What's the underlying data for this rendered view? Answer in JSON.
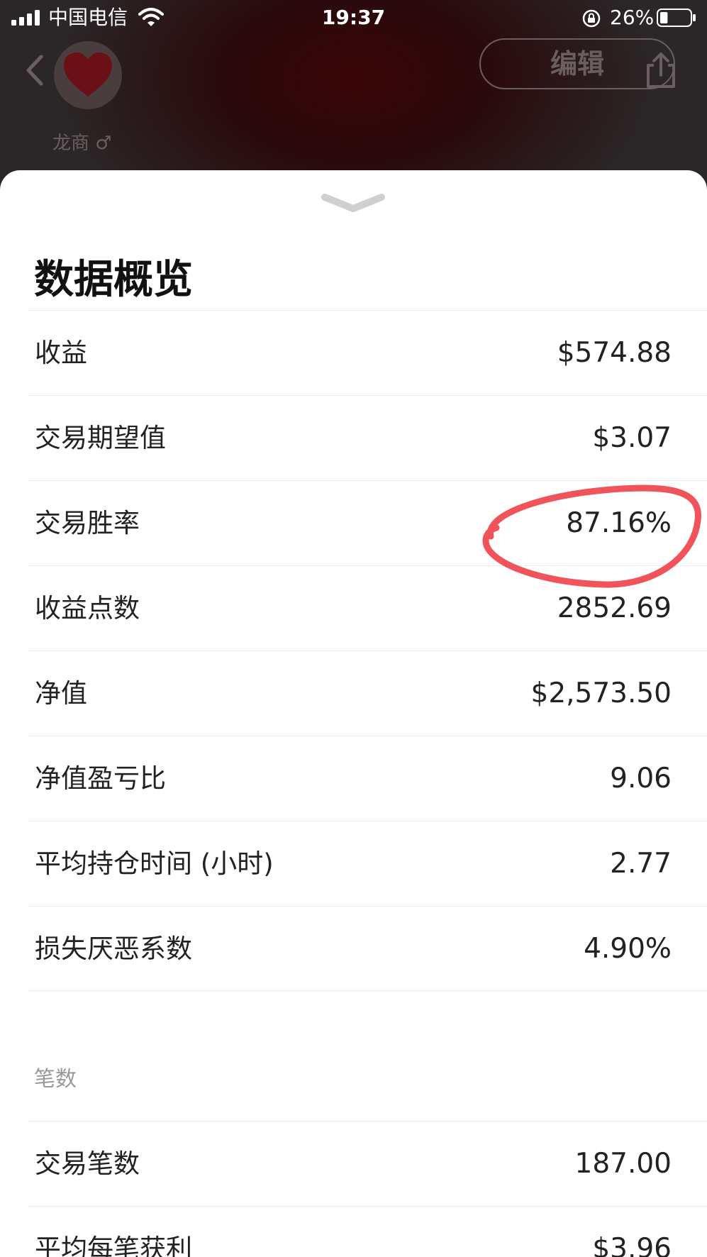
{
  "status_bar": {
    "carrier": "中国电信",
    "time": "19:37",
    "battery_percent": "26%",
    "battery_level": 0.26
  },
  "header": {
    "username": "龙商 ♂",
    "edit_label": "编辑"
  },
  "overview": {
    "title": "数据概览",
    "stats": [
      {
        "label": "收益",
        "value": "$574.88"
      },
      {
        "label": "交易期望值",
        "value": "$3.07"
      },
      {
        "label": "交易胜率",
        "value": "87.16%"
      },
      {
        "label": "收益点数",
        "value": "2852.69"
      },
      {
        "label": "净值",
        "value": "$2,573.50"
      },
      {
        "label": "净值盈亏比",
        "value": "9.06"
      },
      {
        "label": "平均持仓时间 (小时)",
        "value": "2.77"
      },
      {
        "label": "损失厌恶系数",
        "value": "4.90%"
      }
    ]
  },
  "trades": {
    "section_label": "笔数",
    "stats": [
      {
        "label": "交易笔数",
        "value": "187.00"
      },
      {
        "label": "平均每笔获利",
        "value": "$3.96"
      }
    ]
  },
  "colors": {
    "highlight": "#f0545a",
    "backdrop": "#2b2627",
    "accent_dark_red": "#3a0508"
  },
  "icons": [
    "signal-icon",
    "wifi-icon",
    "rotation-lock-icon",
    "battery-icon",
    "back-chevron-icon",
    "heart-icon",
    "share-icon",
    "chevron-down-icon"
  ]
}
